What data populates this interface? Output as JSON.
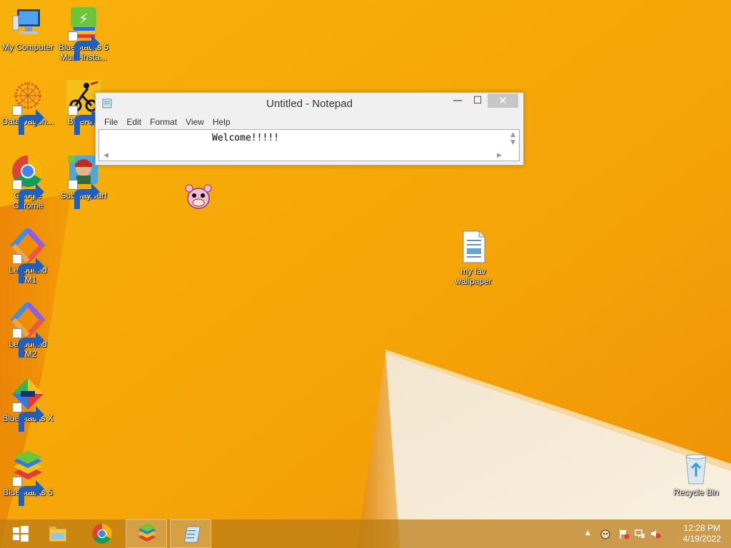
{
  "desktop": {
    "icons": [
      {
        "label": "My Computer",
        "icon": "computer-icon"
      },
      {
        "label": "BlueStacks 5 Multi-Insta...",
        "icon": "bluestacks-multi-instance-icon"
      },
      {
        "label": "DataWagon...",
        "icon": "datawagon-icon"
      },
      {
        "label": "BikeRac",
        "icon": "bikerace-icon"
      },
      {
        "label": "Google Chrome",
        "icon": "chrome-icon"
      },
      {
        "label": "SubwaySurf",
        "icon": "subway-surf-icon"
      },
      {
        "label": "Leapdroid VM1",
        "icon": "leapdroid-icon"
      },
      {
        "label": "Leapdroid VM2",
        "icon": "leapdroid-icon"
      },
      {
        "label": "BlueStacks X",
        "icon": "bluestacks-x-icon"
      },
      {
        "label": "BlueStacks 5",
        "icon": "bluestacks-icon"
      },
      {
        "label": "my fav wallpaper",
        "icon": "text-document-icon"
      },
      {
        "label": "Recycle Bin",
        "icon": "recycle-bin-icon"
      }
    ]
  },
  "notepad": {
    "title": "Untitled - Notepad",
    "minimize": "—",
    "maximize": "☐",
    "close": "✕",
    "menu": [
      "File",
      "Edit",
      "Format",
      "View",
      "Help"
    ],
    "content": "Welcome!!!!!"
  },
  "taskbar": {
    "items": [
      "start-icon",
      "file-explorer-icon",
      "chrome-icon",
      "bluestacks-icon",
      "notepad-icon"
    ],
    "clock_time": "12:28 PM",
    "clock_date": "4/19/2022"
  },
  "colors": {
    "background": "#F6A609",
    "accent": "#E08A00"
  }
}
